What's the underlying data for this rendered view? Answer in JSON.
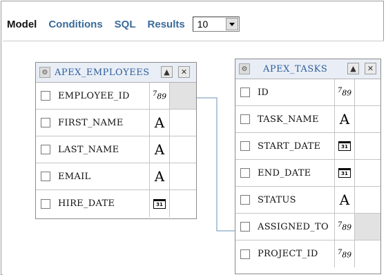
{
  "tabs": [
    {
      "label": "Model"
    },
    {
      "label": "Conditions"
    },
    {
      "label": "SQL"
    },
    {
      "label": "Results"
    }
  ],
  "rows_select": {
    "value": "10"
  },
  "tables": {
    "employees": {
      "title": "APEX_EMPLOYEES",
      "columns": [
        {
          "name": "EMPLOYEE_ID",
          "type": "number",
          "type_glyph": "789"
        },
        {
          "name": "FIRST_NAME",
          "type": "string",
          "type_glyph": "A"
        },
        {
          "name": "LAST_NAME",
          "type": "string",
          "type_glyph": "A"
        },
        {
          "name": "EMAIL",
          "type": "string",
          "type_glyph": "A"
        },
        {
          "name": "HIRE_DATE",
          "type": "date",
          "type_glyph": "31"
        }
      ]
    },
    "tasks": {
      "title": "APEX_TASKS",
      "columns": [
        {
          "name": "ID",
          "type": "number",
          "type_glyph": "789"
        },
        {
          "name": "TASK_NAME",
          "type": "string",
          "type_glyph": "A"
        },
        {
          "name": "START_DATE",
          "type": "date",
          "type_glyph": "31"
        },
        {
          "name": "END_DATE",
          "type": "date",
          "type_glyph": "31"
        },
        {
          "name": "STATUS",
          "type": "string",
          "type_glyph": "A"
        },
        {
          "name": "ASSIGNED_TO",
          "type": "number",
          "type_glyph": "789"
        },
        {
          "name": "PROJECT_ID",
          "type": "number",
          "type_glyph": "789"
        }
      ]
    }
  },
  "join": {
    "from": "APEX_EMPLOYEES.EMPLOYEE_ID",
    "to": "APEX_TASKS.ASSIGNED_TO",
    "color": "#9ab6d0"
  },
  "colors": {
    "tab_active": "#111111",
    "tab_link": "#3a6a9a",
    "header_bg": "#e9eef6",
    "title": "#2d5c9a"
  }
}
